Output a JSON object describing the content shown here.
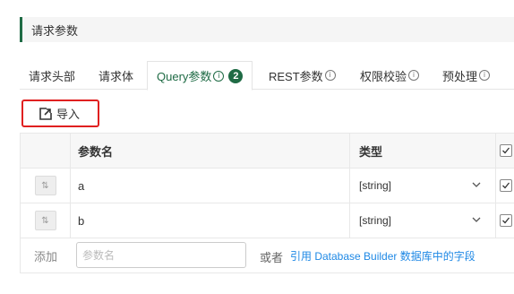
{
  "section": {
    "title": "请求参数"
  },
  "tabs": [
    {
      "label": "请求头部",
      "info": false
    },
    {
      "label": "请求体",
      "info": false
    },
    {
      "label": "Query参数",
      "info": true,
      "badge": "2",
      "active": true
    },
    {
      "label": "REST参数",
      "info": true
    },
    {
      "label": "权限校验",
      "info": true
    },
    {
      "label": "预处理",
      "info": true
    }
  ],
  "info_glyph": "i",
  "toolbar": {
    "import_label": "导入"
  },
  "table": {
    "headers": {
      "name": "参数名",
      "type": "类型"
    },
    "rows": [
      {
        "name": "a",
        "type": "[string]",
        "checked": true
      },
      {
        "name": "b",
        "type": "[string]",
        "checked": true
      }
    ]
  },
  "add_row": {
    "label": "添加",
    "placeholder": "参数名",
    "or_text": "或者",
    "link_text": "引用 Database Builder 数据库中的字段"
  },
  "colors": {
    "accent": "#1f6b45",
    "highlight_border": "#e02020",
    "link": "#1e88e5"
  }
}
